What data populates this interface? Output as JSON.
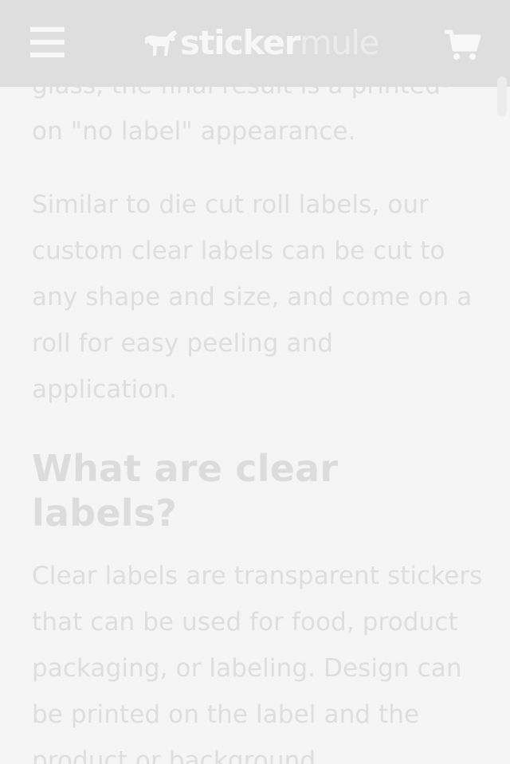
{
  "header": {
    "logo_primary": "sticker",
    "logo_secondary": "mule",
    "menu_icon": "hamburger-menu-icon",
    "cart_icon": "shopping-cart-icon",
    "logo_icon": "mule-logo-icon"
  },
  "article": {
    "para1_line1": "glass, the final result is a printed-",
    "para1_line2": "on \"no label\" appearance.",
    "para2": "Similar to die cut roll labels, our custom clear labels can be cut to any shape and size, and come on a roll for easy peeling and application.",
    "heading": "What are clear labels?",
    "para3": "Clear labels are transparent stickers that can be used for food, product packaging, or labeling. Design can be printed on the label and the product or background"
  },
  "colors": {
    "header_bg": "#dedede",
    "body_bg": "#f5f5f5",
    "text": "#dedede"
  }
}
